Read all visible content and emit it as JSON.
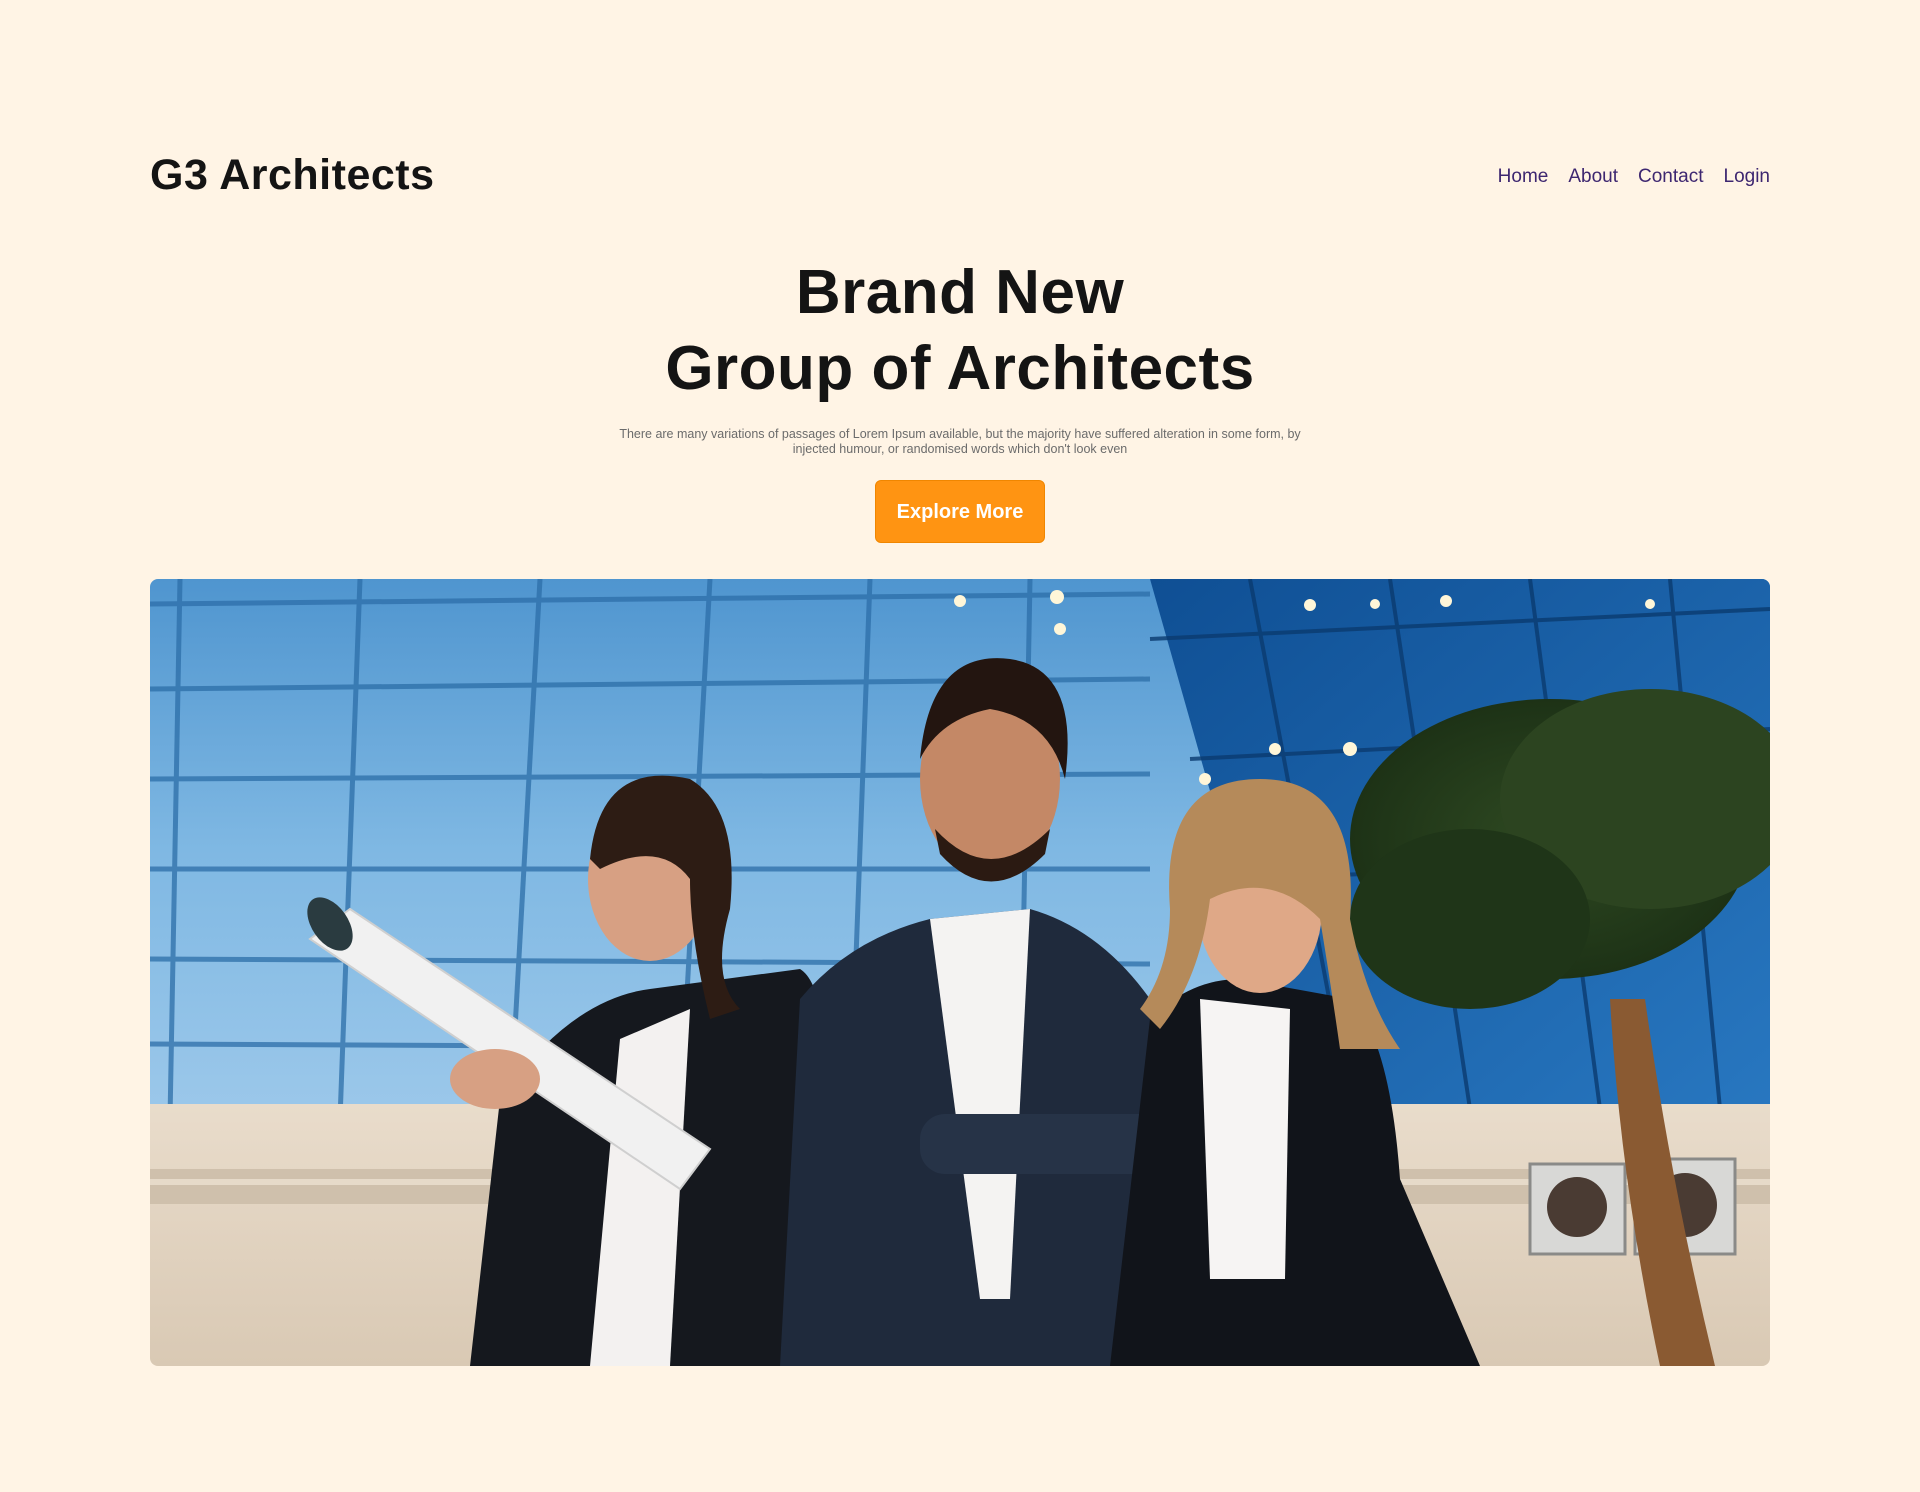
{
  "brand": {
    "name": "G3 Architects"
  },
  "nav": {
    "items": [
      {
        "label": "Home"
      },
      {
        "label": "About"
      },
      {
        "label": "Contact"
      },
      {
        "label": "Login"
      }
    ]
  },
  "hero": {
    "headline_line1": "Brand New",
    "headline_line2": "Group of Architects",
    "subtext": "There are many variations of passages of Lorem Ipsum available, but the majority have suffered alteration in some form, by injected humour, or randomised words which don't look even",
    "cta_label": "Explore More"
  },
  "colors": {
    "background": "#fff4e5",
    "accent": "#ff9412",
    "nav_link": "#3d2670",
    "heading": "#141414"
  }
}
